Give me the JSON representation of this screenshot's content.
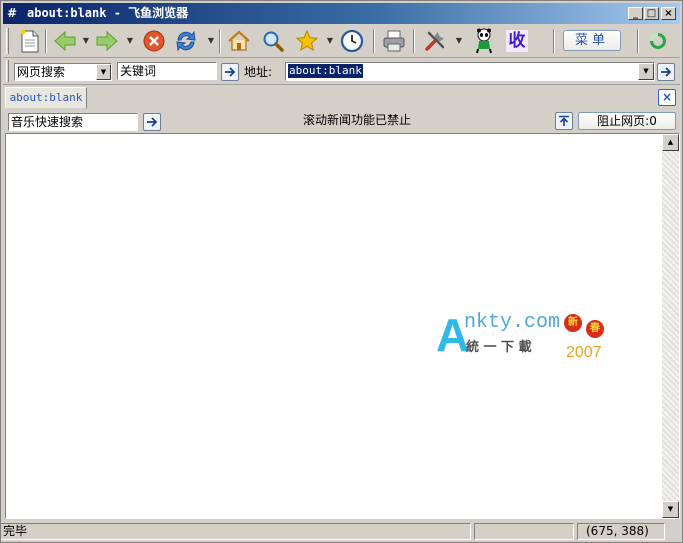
{
  "window": {
    "title": "about:blank - 飞鱼浏览器",
    "title_icon_glyph": "#",
    "minimize_glyph": "_",
    "maximize_glyph": "□",
    "close_glyph": "×"
  },
  "toolbar": {
    "menu_label": "菜单",
    "buttons": [
      {
        "name": "new-page-icon"
      },
      {
        "name": "back-arrow-icon"
      },
      {
        "name": "forward-arrow-icon"
      },
      {
        "name": "stop-icon"
      },
      {
        "name": "refresh-icon"
      },
      {
        "name": "home-icon"
      },
      {
        "name": "search-icon"
      },
      {
        "name": "favorites-star-icon"
      },
      {
        "name": "history-clock-icon"
      },
      {
        "name": "print-icon"
      },
      {
        "name": "tools-icon"
      },
      {
        "name": "panda-icon"
      },
      {
        "name": "collect-icon",
        "label": "收"
      }
    ],
    "colors": {
      "back": "#5aa02c",
      "stop": "#d84a1b",
      "refresh": "#2b6fc4",
      "star": "#f0b400",
      "collect": "#3b1ccc"
    }
  },
  "address_bar": {
    "search_engine": "网页搜索",
    "keyword": "关键词",
    "address_label": "地址:",
    "url": "about:blank"
  },
  "tabs": [
    {
      "label": "about:blank"
    }
  ],
  "info_row": {
    "music_search": "音乐快速搜索",
    "marquee_status": "滚动新闻功能已禁止",
    "block_popup": "阻止网页:0"
  },
  "watermark": {
    "brand_line": "nkty.com",
    "brand_initial": "A",
    "sub_line": "統 一 下 載",
    "year": "2007",
    "lantern_chars": [
      "新",
      "春"
    ]
  },
  "status_bar": {
    "text": "完毕",
    "middle": "",
    "coords": "(675, 388)"
  }
}
